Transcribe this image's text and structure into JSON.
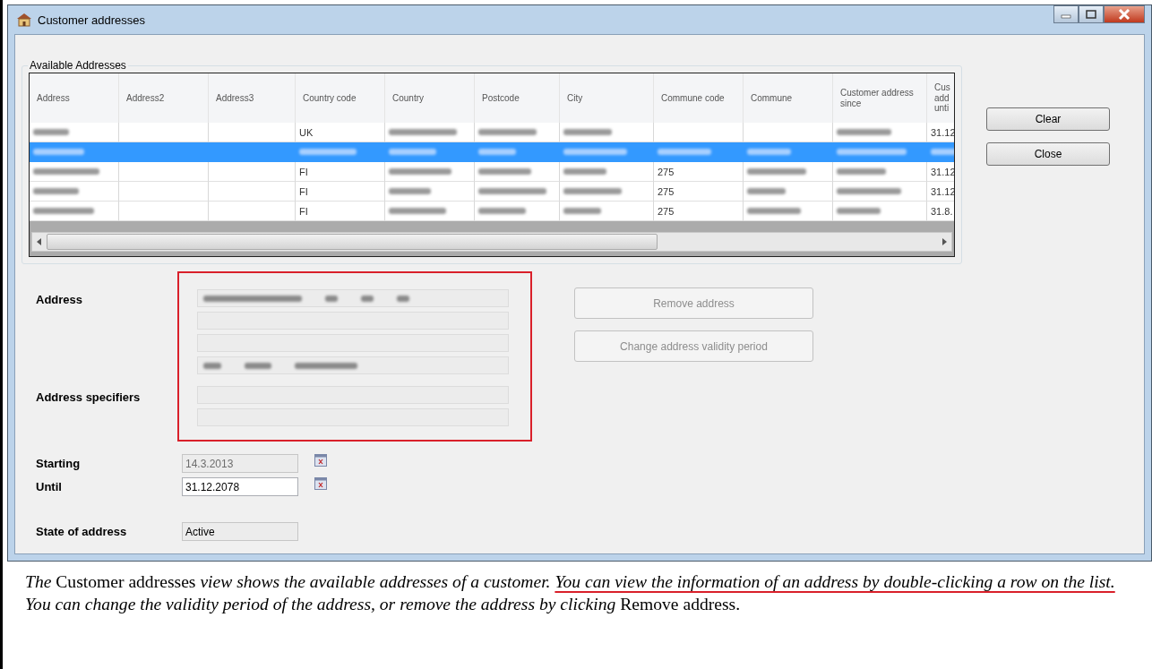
{
  "window": {
    "title": "Customer addresses"
  },
  "addresses": {
    "group_title": "Available Addresses",
    "columns": [
      "Address",
      "Address2",
      "Address3",
      "Country code",
      "Country",
      "Postcode",
      "City",
      "Commune code",
      "Commune",
      "Customer address since",
      "Cus add unti"
    ],
    "rows": [
      {
        "selected": false,
        "cells": [
          {
            "kind": "blurred"
          },
          {
            "kind": "empty"
          },
          {
            "kind": "empty"
          },
          {
            "kind": "text",
            "text": "UK"
          },
          {
            "kind": "blurred"
          },
          {
            "kind": "blurred"
          },
          {
            "kind": "blurred"
          },
          {
            "kind": "empty"
          },
          {
            "kind": "empty"
          },
          {
            "kind": "blurred"
          },
          {
            "kind": "text",
            "text": "31.12"
          }
        ]
      },
      {
        "selected": true,
        "cells": [
          {
            "kind": "blurred"
          },
          {
            "kind": "empty"
          },
          {
            "kind": "empty"
          },
          {
            "kind": "blurred"
          },
          {
            "kind": "blurred"
          },
          {
            "kind": "blurred"
          },
          {
            "kind": "blurred"
          },
          {
            "kind": "blurred"
          },
          {
            "kind": "blurred"
          },
          {
            "kind": "blurred"
          },
          {
            "kind": "blurred"
          }
        ]
      },
      {
        "selected": false,
        "cells": [
          {
            "kind": "blurred"
          },
          {
            "kind": "empty"
          },
          {
            "kind": "empty"
          },
          {
            "kind": "text",
            "text": "FI"
          },
          {
            "kind": "blurred"
          },
          {
            "kind": "blurred"
          },
          {
            "kind": "blurred"
          },
          {
            "kind": "text",
            "text": "275"
          },
          {
            "kind": "blurred"
          },
          {
            "kind": "blurred"
          },
          {
            "kind": "text",
            "text": "31.12"
          }
        ]
      },
      {
        "selected": false,
        "cells": [
          {
            "kind": "blurred"
          },
          {
            "kind": "empty"
          },
          {
            "kind": "empty"
          },
          {
            "kind": "text",
            "text": "FI"
          },
          {
            "kind": "blurred"
          },
          {
            "kind": "blurred"
          },
          {
            "kind": "blurred"
          },
          {
            "kind": "text",
            "text": "275"
          },
          {
            "kind": "blurred"
          },
          {
            "kind": "blurred"
          },
          {
            "kind": "text",
            "text": "31.12"
          }
        ]
      },
      {
        "selected": false,
        "cells": [
          {
            "kind": "blurred"
          },
          {
            "kind": "empty"
          },
          {
            "kind": "empty"
          },
          {
            "kind": "text",
            "text": "FI"
          },
          {
            "kind": "blurred"
          },
          {
            "kind": "blurred"
          },
          {
            "kind": "blurred"
          },
          {
            "kind": "text",
            "text": "275"
          },
          {
            "kind": "blurred"
          },
          {
            "kind": "blurred"
          },
          {
            "kind": "text",
            "text": "31.8."
          }
        ]
      }
    ]
  },
  "side_buttons": [
    {
      "label": "Clear",
      "disabled": false
    },
    {
      "label": "Close",
      "disabled": false
    }
  ],
  "address": {
    "label": "Address",
    "fields": [
      {
        "kind": "blurred"
      },
      {
        "kind": "empty"
      },
      {
        "kind": "empty"
      },
      {
        "kind": "blurred"
      }
    ]
  },
  "address_specifiers": {
    "label": "Address specifiers"
  },
  "action_buttons": [
    {
      "label": "Remove address",
      "disabled": true
    },
    {
      "label": "Change address validity period",
      "disabled": true
    }
  ],
  "dates": [
    {
      "label": "Starting",
      "value": "14.3.2013",
      "disabled": true
    },
    {
      "label": "Until",
      "value": "31.12.2078",
      "disabled": false
    }
  ],
  "state_of_address": {
    "label": "State of address",
    "value": "Active"
  },
  "caption": {
    "segments": [
      {
        "text": "The",
        "italic": true,
        "underlined": false
      },
      {
        "text": " Customer addresses ",
        "italic": false,
        "underlined": false
      },
      {
        "text": "view shows the available addresses of a customer. ",
        "italic": true,
        "underlined": false
      },
      {
        "text": "You can view the information of an address by double-clicking a row on the list.",
        "italic": true,
        "underlined": true
      },
      {
        "text": " You can change the validity period of the address, or remove the address by clicking",
        "italic": true,
        "underlined": false
      },
      {
        "text": " Remove address.",
        "italic": false,
        "underlined": false
      }
    ]
  }
}
